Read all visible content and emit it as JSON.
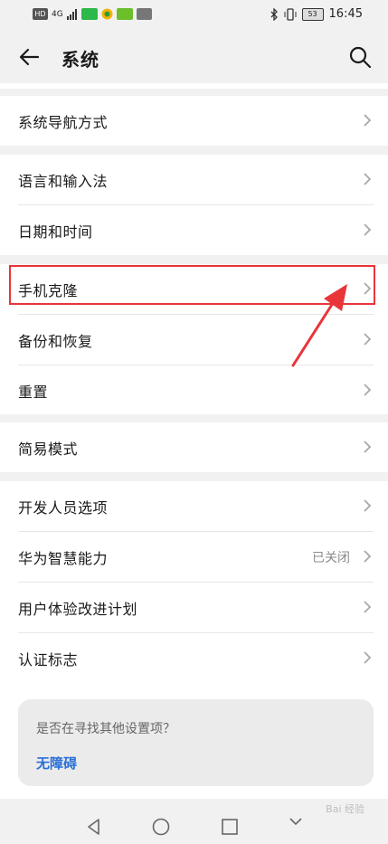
{
  "status_bar": {
    "left_icons": [
      "HD",
      "4G",
      "signal",
      "app-badge",
      "wechat",
      "app-badge-2",
      "app-square"
    ],
    "battery": "53",
    "time": "16:45"
  },
  "header": {
    "title": "系统",
    "back_icon": "back-arrow-icon",
    "search_icon": "search-icon"
  },
  "groups": [
    {
      "items": [
        {
          "label": "系统导航方式"
        }
      ]
    },
    {
      "items": [
        {
          "label": "语言和输入法"
        },
        {
          "label": "日期和时间"
        }
      ]
    },
    {
      "items": [
        {
          "label": "手机克隆"
        },
        {
          "label": "备份和恢复"
        },
        {
          "label": "重置"
        }
      ]
    },
    {
      "items": [
        {
          "label": "简易模式"
        }
      ]
    },
    {
      "items": [
        {
          "label": "开发人员选项"
        },
        {
          "label": "华为智慧能力",
          "status": "已关闭"
        },
        {
          "label": "用户体验改进计划"
        },
        {
          "label": "认证标志"
        }
      ]
    }
  ],
  "suggestion": {
    "question": "是否在寻找其他设置项？",
    "link": "无障碍"
  },
  "watermark": "Bai 经验",
  "colors": {
    "highlight": "#e8353a",
    "link": "#2a6fd6",
    "background": "#f1f1f1"
  }
}
